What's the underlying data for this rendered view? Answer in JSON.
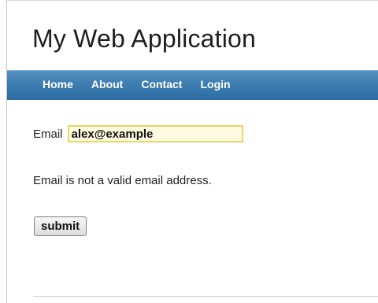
{
  "app": {
    "title": "My Web Application"
  },
  "nav": {
    "items": [
      {
        "label": "Home"
      },
      {
        "label": "About"
      },
      {
        "label": "Contact"
      },
      {
        "label": "Login"
      }
    ]
  },
  "form": {
    "email_label": "Email",
    "email_value": "alex@example",
    "error_message": "Email is not a valid email address.",
    "submit_label": "submit"
  },
  "colors": {
    "nav_background": "#3e7db1",
    "input_border": "#e8d56b",
    "input_background": "#fffbe0"
  }
}
